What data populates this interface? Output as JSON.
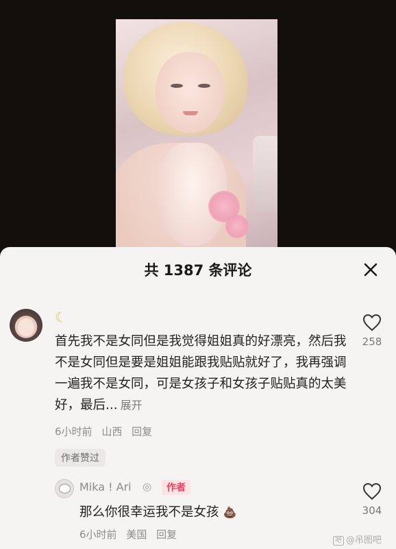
{
  "sheet": {
    "title": "共 1387 条评论",
    "close_icon": "close-icon"
  },
  "comments": [
    {
      "avatar_icon": "user-avatar",
      "badge_icon": "moon-icon",
      "text": "首先我不是女同但是我觉得姐姐真的好漂亮，然后我不是女同但是要是姐姐能跟我贴贴就好了，我再强调一遍我不是女同，可是女孩子和女孩子贴贴真的太美好，最后...",
      "expand_label": "展开",
      "time": "6小时前",
      "location": "山西",
      "reply_label": "回复",
      "author_liked_label": "作者赞过",
      "likes": "258"
    }
  ],
  "reply": {
    "avatar_icon": "dog-avatar",
    "username": "Mika ! Ari",
    "ring_icon": "ring-icon",
    "author_badge": "作者",
    "text": "那么你很幸运我不是女孩",
    "emoji_icon": "poop-emoji-icon",
    "time": "6小时前",
    "location": "美国",
    "reply_label": "回复",
    "likes": "304"
  },
  "watermark": {
    "text": "@吊图吧",
    "box_glyph": "吧"
  },
  "colors": {
    "background_dark": "#120f0d",
    "sheet_bg": "#f6f4f3",
    "author_badge": "#f0405e"
  }
}
